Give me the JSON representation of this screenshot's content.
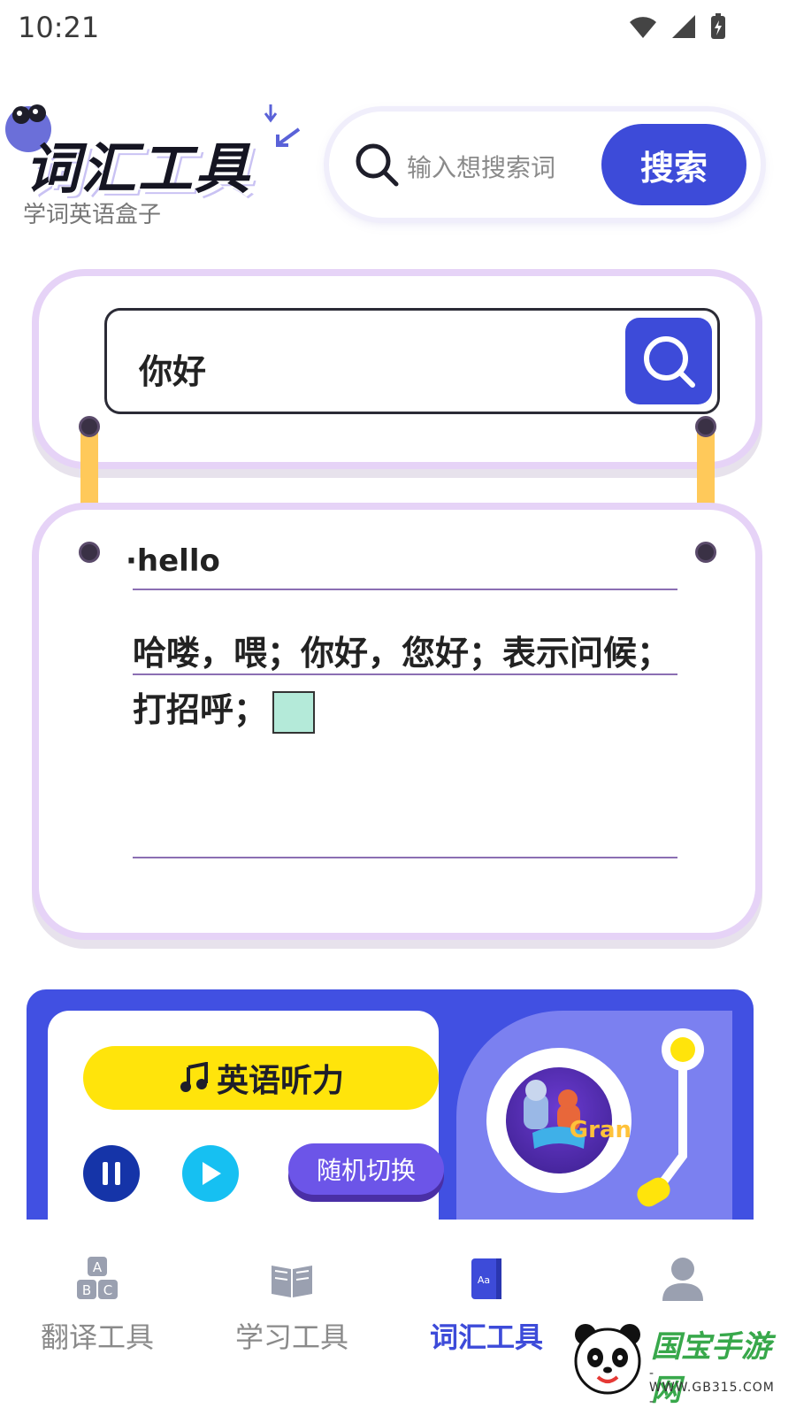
{
  "status_bar": {
    "time": "10:21"
  },
  "header": {
    "app_title": "词汇工具",
    "subtitle": "学词英语盒子",
    "search": {
      "placeholder": "输入想搜索词",
      "button_label": "搜索"
    }
  },
  "query": {
    "value": "你好"
  },
  "result": {
    "word": "·hello",
    "meaning": "哈喽，喂；你好，您好；表示问候；打招呼；"
  },
  "listening": {
    "title": "英语听力",
    "random_label": "随机切换",
    "disc_label": "H\nGran"
  },
  "bottom_nav": {
    "items": [
      {
        "label": "翻译工具",
        "icon": "abc-blocks-icon"
      },
      {
        "label": "学习工具",
        "icon": "book-icon"
      },
      {
        "label": "词汇工具",
        "icon": "dictionary-icon"
      },
      {
        "label": "",
        "icon": "user-icon"
      }
    ]
  },
  "watermark": {
    "title": "国宝手游网",
    "url": "- WWW.GB315.COM -"
  },
  "colors": {
    "accent": "#3d4bd9",
    "card_border": "#e6d3f7",
    "yellow": "#ffe40b",
    "panel": "#4150e2"
  }
}
